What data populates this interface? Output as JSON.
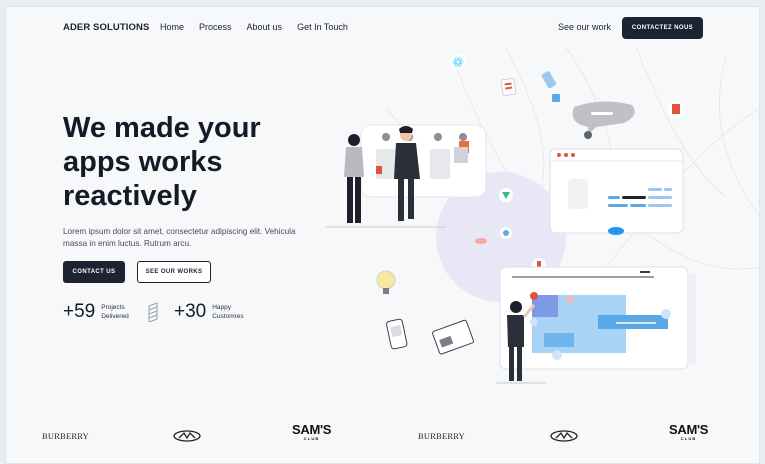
{
  "nav": {
    "brand": "ADER SOLUTIONS",
    "links": [
      "Home",
      "Process",
      "About us",
      "Get In Touch"
    ],
    "see_work": "See our work",
    "contact": "CONTACTEZ NOUS"
  },
  "hero": {
    "headline": [
      "We made your",
      "apps works",
      "reactively"
    ],
    "subtitle": "Lorem ipsum dolor sit amet, consectetur adipiscing elit. Vehicula massa in enim luctus. Rutrum arcu.",
    "primary_button": "CONTACT US",
    "secondary_button": "SEE OUR WORKS",
    "stats": [
      {
        "value": "+59",
        "label_line1": "Projects",
        "label_line2": "Delivered"
      },
      {
        "value": "+30",
        "label_line1": "Happy",
        "label_line2": "Customres"
      }
    ]
  },
  "logos": [
    "BURBERRY",
    "lidl-style-logo",
    "SAM'S",
    "BURBERRY",
    "lidl-style-logo",
    "SAM'S"
  ],
  "sams_sub": "CLUB",
  "colors": {
    "dark": "#1c2432",
    "accent_blue": "#5aa9e6",
    "accent_purple": "#e9e8f7",
    "accent_red": "#e0533d"
  }
}
